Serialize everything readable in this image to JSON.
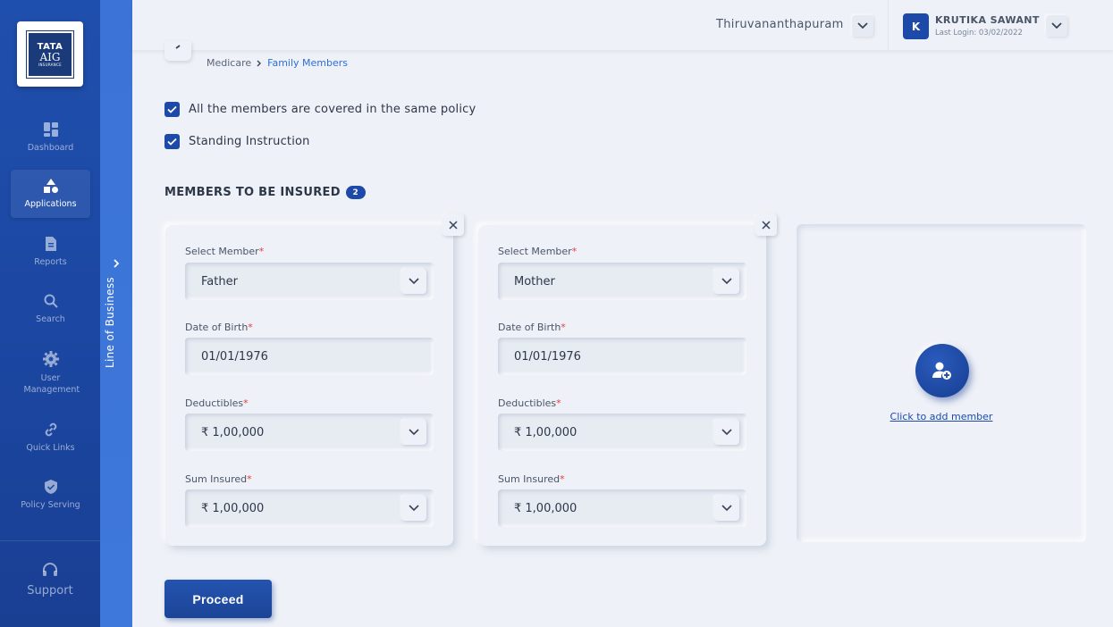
{
  "brand": {
    "logo_line1": "TATA",
    "logo_line2": "AIG",
    "logo_line3": "INSURANCE",
    "primary_color": "#1d4aa8",
    "accent_color": "#3e78da"
  },
  "sidebar": {
    "items": [
      {
        "label": "Dashboard",
        "icon": "dashboard-icon"
      },
      {
        "label": "Applications",
        "icon": "shapes-icon"
      },
      {
        "label": "Reports",
        "icon": "document-icon"
      },
      {
        "label": "Search",
        "icon": "search-icon"
      },
      {
        "label": "User Management",
        "icon": "gear-icon"
      },
      {
        "label": "Quick Links",
        "icon": "link-icon"
      },
      {
        "label": "Policy Serving",
        "icon": "shield-icon"
      }
    ],
    "active": "Applications",
    "support_label": "Support"
  },
  "lob": {
    "label": "Line of Business"
  },
  "header": {
    "city": "Thiruvananthapuram",
    "user_initial": "K",
    "user_name": "KRUTIKA SAWANT",
    "last_login": "Last Login: 03/02/2022"
  },
  "breadcrumb": {
    "parent": "Medicare",
    "current": "Family Members"
  },
  "options": {
    "same_policy": {
      "label": "All the members are covered in the same policy",
      "checked": true
    },
    "standing_instruction": {
      "label": "Standing Instruction",
      "checked": true
    }
  },
  "members_section": {
    "title": "MEMBERS TO BE INSURED",
    "count": "2"
  },
  "form_labels": {
    "select_member": "Select Member",
    "dob": "Date of Birth",
    "deductibles": "Deductibles",
    "sum_insured": "Sum Insured",
    "required_mark": "*"
  },
  "members": [
    {
      "member": "Father",
      "dob": "01/01/1976",
      "deductibles": "₹ 1,00,000",
      "sum_insured": "₹ 1,00,000"
    },
    {
      "member": "Mother",
      "dob": "01/01/1976",
      "deductibles": "₹ 1,00,000",
      "sum_insured": "₹ 1,00,000"
    }
  ],
  "add_member": {
    "label": "Click to add member",
    "icon": "add-user-icon"
  },
  "actions": {
    "proceed_label": "Proceed"
  }
}
